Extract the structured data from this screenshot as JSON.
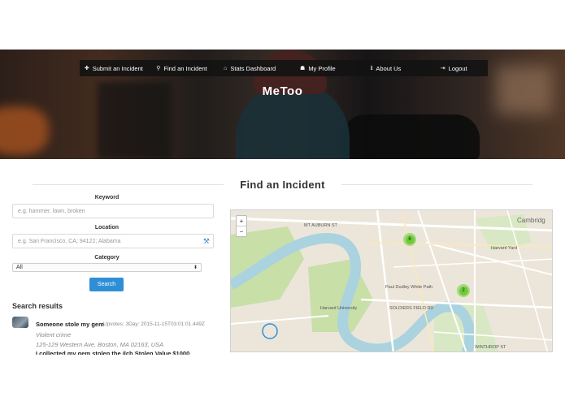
{
  "nav": {
    "items": [
      {
        "icon": "plus-icon",
        "glyph": "✚",
        "label": "Submit an Incident"
      },
      {
        "icon": "search-icon",
        "glyph": "⚲",
        "label": "Find an Incident"
      },
      {
        "icon": "home-icon",
        "glyph": "⌂",
        "label": "Stats Dashboard"
      },
      {
        "icon": "user-icon",
        "glyph": "☗",
        "label": "My Profile"
      },
      {
        "icon": "info-icon",
        "glyph": "ℹ",
        "label": "About Us"
      },
      {
        "icon": "logout-icon",
        "glyph": "⇥",
        "label": "Logout"
      }
    ]
  },
  "hero": {
    "brand": "MeToo"
  },
  "page": {
    "title": "Find an Incident"
  },
  "form": {
    "keyword_label": "Keyword",
    "keyword_placeholder": "e.g. hammer, lawn, broken",
    "location_label": "Location",
    "location_placeholder": "e.g. San Francisco, CA; 94122; Alabama",
    "category_label": "Category",
    "category_value": "All",
    "search_button": "Search"
  },
  "results": {
    "title": "Search results",
    "items": [
      {
        "title": "Someone stole my gem",
        "meta": "Upvotes: 3Day: 2015-11-15T03:01:01.449Z",
        "type": "Violent crime",
        "address": "125-129 Western Ave, Boston, MA 02163, USA",
        "description": "I collected my gem stolen the ilch Stolen Value $1000"
      }
    ]
  },
  "map": {
    "zoom_in": "+",
    "zoom_out": "−",
    "clusters": [
      {
        "count": "6"
      },
      {
        "count": "2"
      }
    ],
    "labels": {
      "cambridge": "Cambridg",
      "harvard_university": "Harvard University",
      "mount_auburn": "MT AUBURN ST",
      "soldiers_field": "SOLDIERS FIELD RD",
      "paul_dudley": "Paul Dudley White Path",
      "harvard_yard": "Harvard Yard",
      "winthrop": "WINTHROP ST"
    },
    "colors": {
      "water": "#aad3df",
      "park": "#c8dfa8",
      "land": "#ece6da",
      "road": "#ffffff"
    }
  }
}
